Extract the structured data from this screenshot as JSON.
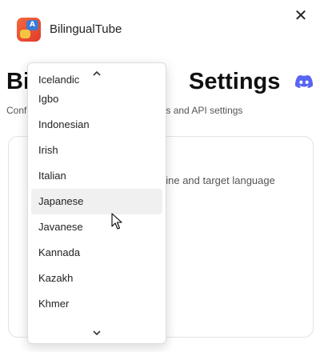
{
  "app": {
    "name": "BilingualTube",
    "logo_icon": "bilingual-logo-icon"
  },
  "page": {
    "title_left": "Bi",
    "title_right": "Settings",
    "subtitle_left": "Conf",
    "subtitle_right": "s and API settings",
    "card_desc": "gine and target language"
  },
  "dropdown": {
    "options": [
      "Icelandic",
      "Igbo",
      "Indonesian",
      "Irish",
      "Italian",
      "Japanese",
      "Javanese",
      "Kannada",
      "Kazakh",
      "Khmer"
    ],
    "highlighted": "Japanese"
  },
  "colors": {
    "accent": "#5865F2",
    "highlight": "#f0f0f0",
    "logo": "#e23a2d"
  }
}
